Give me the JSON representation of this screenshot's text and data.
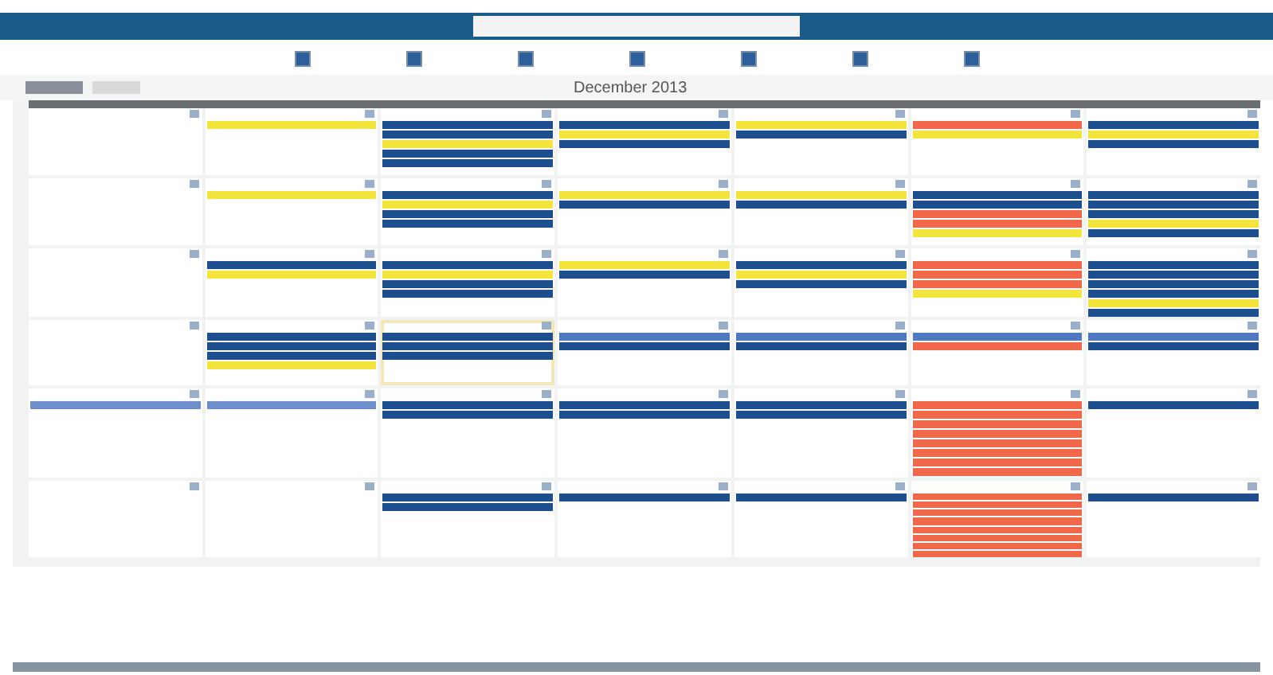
{
  "calendar": {
    "title": "December 2013"
  },
  "filters": [
    {
      "checked": true
    },
    {
      "checked": true
    },
    {
      "checked": true
    },
    {
      "checked": true
    },
    {
      "checked": true
    },
    {
      "checked": true
    },
    {
      "checked": true
    }
  ],
  "weeks": [
    {
      "days": [
        {
          "today": false
        },
        {
          "today": false,
          "events": [
            {
              "color": "#f2e43a"
            }
          ]
        },
        {
          "today": false,
          "events": [
            {
              "color": "#1d4f8f"
            },
            {
              "color": "#1d4f8f"
            },
            {
              "color": "#f2e43a"
            },
            {
              "color": "#1d4f8f"
            },
            {
              "color": "#1d4f8f"
            }
          ]
        },
        {
          "today": false,
          "events": [
            {
              "color": "#1d4f8f"
            },
            {
              "color": "#f2e43a"
            },
            {
              "color": "#1d4f8f"
            }
          ]
        },
        {
          "today": false,
          "events": [
            {
              "color": "#f2e43a"
            },
            {
              "color": "#1d4f8f"
            }
          ]
        },
        {
          "today": false,
          "events": [
            {
              "color": "#f0674a"
            },
            {
              "color": "#f2e43a"
            }
          ]
        },
        {
          "today": false,
          "events": [
            {
              "color": "#1d4f8f"
            },
            {
              "color": "#f2e43a"
            },
            {
              "color": "#1d4f8f"
            }
          ]
        }
      ]
    },
    {
      "days": [
        {
          "today": false
        },
        {
          "today": false,
          "events": [
            {
              "color": "#f2e43a"
            }
          ]
        },
        {
          "today": false,
          "events": [
            {
              "color": "#1d4f8f"
            },
            {
              "color": "#f2e43a"
            },
            {
              "color": "#1d4f8f"
            },
            {
              "color": "#1d4f8f"
            }
          ]
        },
        {
          "today": false,
          "events": [
            {
              "color": "#f2e43a"
            },
            {
              "color": "#1d4f8f"
            }
          ]
        },
        {
          "today": false,
          "events": [
            {
              "color": "#f2e43a"
            },
            {
              "color": "#1d4f8f"
            }
          ]
        },
        {
          "today": false,
          "events": [
            {
              "color": "#1d4f8f"
            },
            {
              "color": "#1d4f8f"
            },
            {
              "color": "#f0674a"
            },
            {
              "color": "#f0674a"
            },
            {
              "color": "#f2e43a"
            }
          ]
        },
        {
          "today": false,
          "events": [
            {
              "color": "#1d4f8f"
            },
            {
              "color": "#1d4f8f"
            },
            {
              "color": "#1d4f8f"
            },
            {
              "color": "#f2e43a"
            },
            {
              "color": "#1d4f8f"
            }
          ]
        }
      ]
    },
    {
      "days": [
        {
          "today": false
        },
        {
          "today": false,
          "events": [
            {
              "color": "#1d4f8f"
            },
            {
              "color": "#f2e43a"
            }
          ]
        },
        {
          "today": false,
          "events": [
            {
              "color": "#1d4f8f"
            },
            {
              "color": "#f2e43a"
            },
            {
              "color": "#1d4f8f"
            },
            {
              "color": "#1d4f8f"
            }
          ]
        },
        {
          "today": false,
          "events": [
            {
              "color": "#f2e43a"
            },
            {
              "color": "#1d4f8f"
            }
          ]
        },
        {
          "today": false,
          "events": [
            {
              "color": "#1d4f8f"
            },
            {
              "color": "#f2e43a"
            },
            {
              "color": "#1d4f8f"
            }
          ]
        },
        {
          "today": false,
          "events": [
            {
              "color": "#f0674a"
            },
            {
              "color": "#f0674a"
            },
            {
              "color": "#f0674a"
            },
            {
              "color": "#f2e43a"
            }
          ]
        },
        {
          "today": false,
          "events": [
            {
              "color": "#1d4f8f"
            },
            {
              "color": "#1d4f8f"
            },
            {
              "color": "#1d4f8f"
            },
            {
              "color": "#1d4f8f"
            },
            {
              "color": "#f2e43a"
            },
            {
              "color": "#1d4f8f"
            }
          ]
        }
      ]
    },
    {
      "days": [
        {
          "today": false
        },
        {
          "today": false,
          "events": [
            {
              "color": "#1d4f8f"
            },
            {
              "color": "#1d4f8f"
            },
            {
              "color": "#1d4f8f"
            },
            {
              "color": "#f2e43a"
            }
          ]
        },
        {
          "today": true,
          "events": [
            {
              "color": "#1d4f8f"
            },
            {
              "color": "#1d4f8f"
            },
            {
              "color": "#1d4f8f"
            }
          ]
        },
        {
          "today": false,
          "events": [
            {
              "color": "#4f78c0"
            },
            {
              "color": "#1d4f8f"
            }
          ]
        },
        {
          "today": false,
          "events": [
            {
              "color": "#4f78c0"
            },
            {
              "color": "#1d4f8f"
            }
          ]
        },
        {
          "today": false,
          "events": [
            {
              "color": "#4f78c0"
            },
            {
              "color": "#f0674a"
            }
          ]
        },
        {
          "today": false,
          "events": [
            {
              "color": "#4f78c0"
            },
            {
              "color": "#1d4f8f"
            }
          ]
        }
      ]
    },
    {
      "days": [
        {
          "today": false,
          "events": [
            {
              "color": "#6f8fcc"
            }
          ]
        },
        {
          "today": false,
          "events": [
            {
              "color": "#6f8fcc"
            }
          ]
        },
        {
          "today": false,
          "events": [
            {
              "color": "#1d4f8f"
            },
            {
              "color": "#1d4f8f"
            }
          ]
        },
        {
          "today": false,
          "events": [
            {
              "color": "#1d4f8f"
            },
            {
              "color": "#1d4f8f"
            }
          ]
        },
        {
          "today": false,
          "events": [
            {
              "color": "#1d4f8f"
            },
            {
              "color": "#1d4f8f"
            }
          ]
        },
        {
          "today": false,
          "events": [
            {
              "color": "#f0674a"
            },
            {
              "color": "#f0674a"
            },
            {
              "color": "#f0674a"
            },
            {
              "color": "#f0674a"
            },
            {
              "color": "#f0674a"
            },
            {
              "color": "#f0674a"
            },
            {
              "color": "#f0674a"
            },
            {
              "color": "#f0674a"
            }
          ]
        },
        {
          "today": false,
          "events": [
            {
              "color": "#1d4f8f"
            }
          ]
        }
      ]
    },
    {
      "days": [
        {
          "today": false
        },
        {
          "today": false
        },
        {
          "today": false,
          "events": [
            {
              "color": "#1d4f8f"
            },
            {
              "color": "#1d4f8f"
            }
          ]
        },
        {
          "today": false,
          "events": [
            {
              "color": "#1d4f8f"
            }
          ]
        },
        {
          "today": false,
          "events": [
            {
              "color": "#1d4f8f"
            }
          ]
        },
        {
          "today": false,
          "events": [
            {
              "color": "#f0674a"
            },
            {
              "color": "#f0674a"
            },
            {
              "color": "#f0674a"
            },
            {
              "color": "#f0674a"
            },
            {
              "color": "#f0674a"
            },
            {
              "color": "#f0674a"
            },
            {
              "color": "#f0674a"
            },
            {
              "color": "#f0674a"
            }
          ]
        },
        {
          "today": false,
          "events": [
            {
              "color": "#1d4f8f"
            }
          ]
        }
      ]
    }
  ]
}
